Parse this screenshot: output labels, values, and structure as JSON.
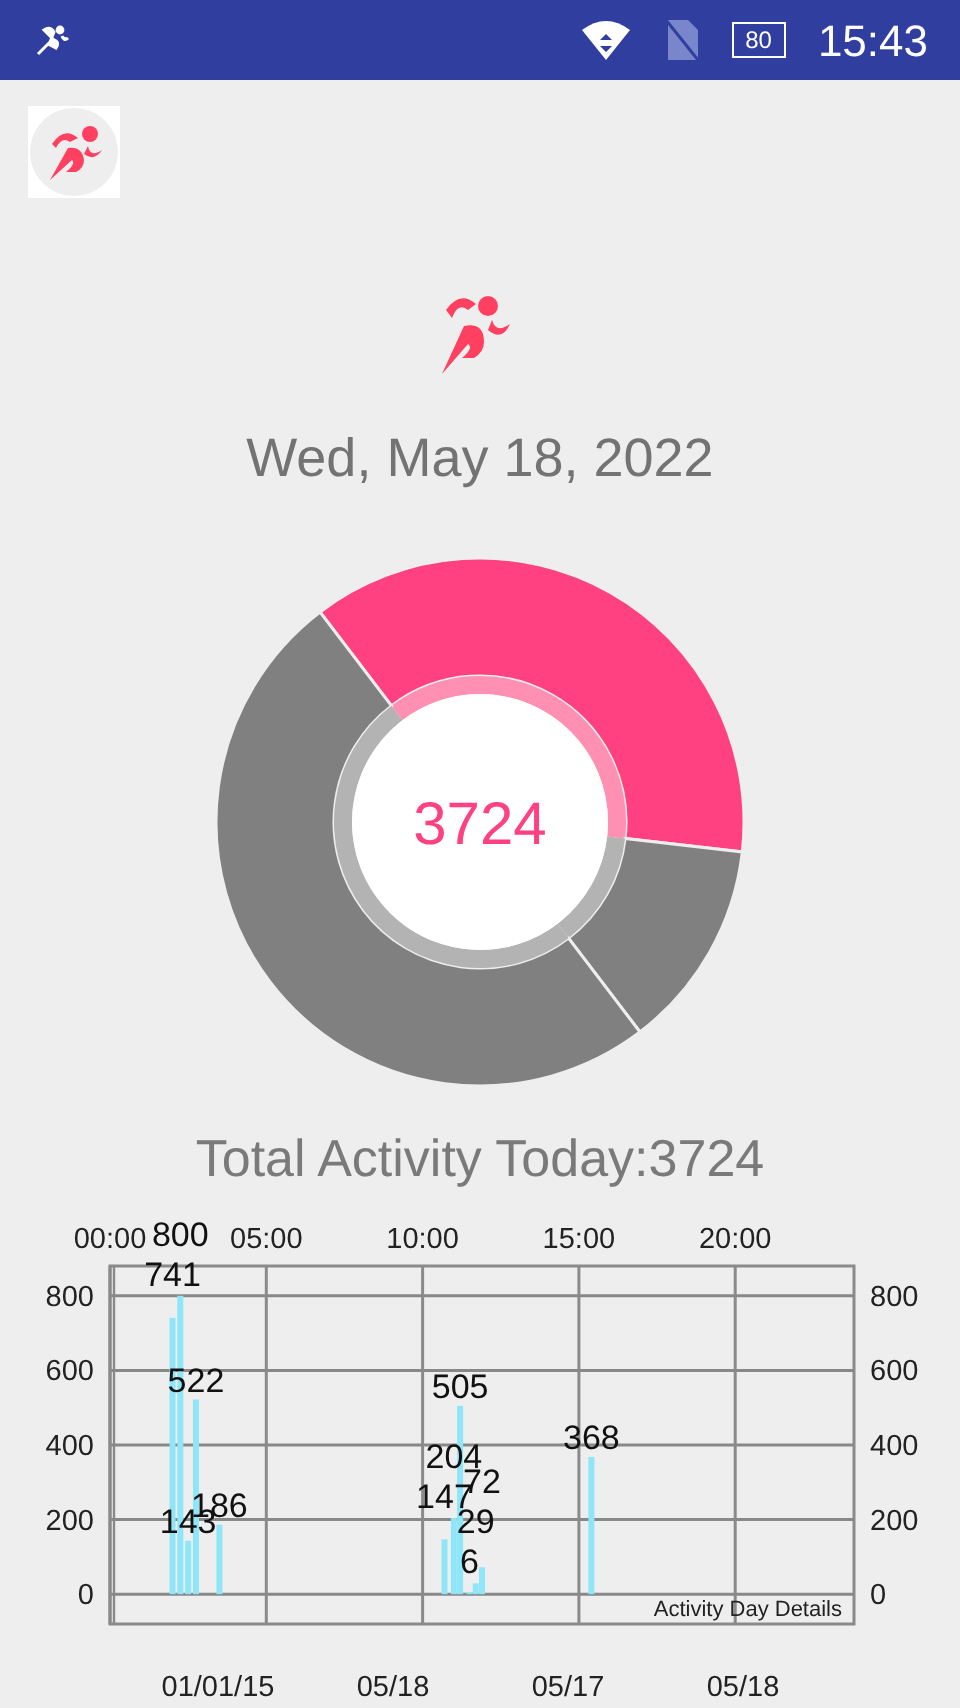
{
  "status_bar": {
    "battery": "80",
    "time": "15:43"
  },
  "date": "Wed, May 18, 2022",
  "donut": {
    "center_value": "3724"
  },
  "total_label": "Total Activity Today:3724",
  "activity_chart": {
    "description": "Activity Day Details",
    "bottom_labels": [
      "01/01/15",
      "05/18",
      "05/17",
      "05/18"
    ],
    "chart_data": {
      "type": "bar",
      "x": [
        2.0,
        2.25,
        2.5,
        2.75,
        3.5,
        10.7,
        11.0,
        11.2,
        11.5,
        11.7,
        11.9,
        15.4
      ],
      "series": [
        {
          "color": "#8ee6f8",
          "values": [
            741,
            800,
            143,
            522,
            186,
            147,
            204,
            505,
            6,
            29,
            72,
            368
          ]
        }
      ],
      "xlim": [
        0,
        23.8
      ],
      "ylim": [
        -80,
        880
      ],
      "xticks": [
        {
          "value": 0,
          "label": "00:00"
        },
        {
          "value": 5,
          "label": "05:00"
        },
        {
          "value": 10,
          "label": "10:00"
        },
        {
          "value": 15,
          "label": "15:00"
        },
        {
          "value": 20,
          "label": "20:00"
        }
      ],
      "yticks": [
        0,
        200,
        400,
        600,
        800
      ],
      "y2ticks": [
        0,
        200,
        400,
        600,
        800
      ],
      "y2lim": [
        -80,
        880
      ],
      "grid": true,
      "data_labels": true
    }
  }
}
